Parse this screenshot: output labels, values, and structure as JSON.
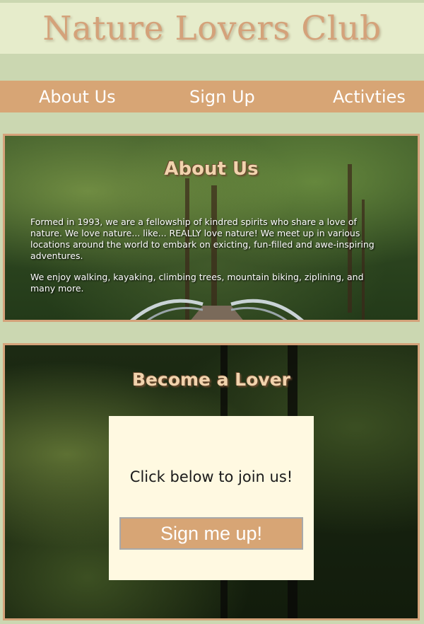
{
  "site": {
    "title": "Nature Lovers Club"
  },
  "nav": {
    "items": [
      {
        "label": "About Us"
      },
      {
        "label": "Sign Up"
      },
      {
        "label": "Activties"
      }
    ]
  },
  "about": {
    "heading": "About Us",
    "paragraphs": [
      "Formed in 1993, we are a fellowship of kindred spirits who share a love of nature. We love nature... like... REALLY love nature! We meet up in various locations around the world to embark on exicting, fun-filled and awe-inspiring adventures.",
      "We enjoy walking, kayaking, climbing trees, mountain biking, ziplining, and many more."
    ]
  },
  "signup": {
    "heading": "Become a Lover",
    "prompt": "Click below to join us!",
    "button_label": "Sign me up!"
  },
  "colors": {
    "page_bg": "#cbd7b1",
    "title_band": "#e6eccb",
    "accent_tan": "#d7a575",
    "card_bg": "#fff9e1"
  }
}
